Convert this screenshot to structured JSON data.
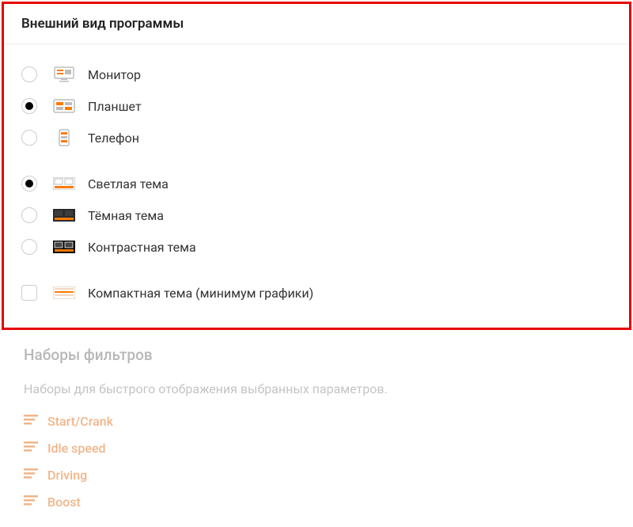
{
  "appearance": {
    "title": "Внешний вид программы",
    "device": {
      "monitor": "Монитор",
      "tablet": "Планшет",
      "phone": "Телефон",
      "selected": "tablet"
    },
    "theme": {
      "light": "Светлая тема",
      "dark": "Тёмная тема",
      "contrast": "Контрастная тема",
      "selected": "light"
    },
    "compact": {
      "label": "Компактная тема (минимум графики)",
      "checked": false
    }
  },
  "filters": {
    "title": "Наборы фильтров",
    "description": "Наборы для быстрого отображения выбранных параметров.",
    "items": [
      {
        "name": "Start/Crank"
      },
      {
        "name": "Idle speed"
      },
      {
        "name": "Driving"
      },
      {
        "name": "Boost"
      }
    ]
  }
}
